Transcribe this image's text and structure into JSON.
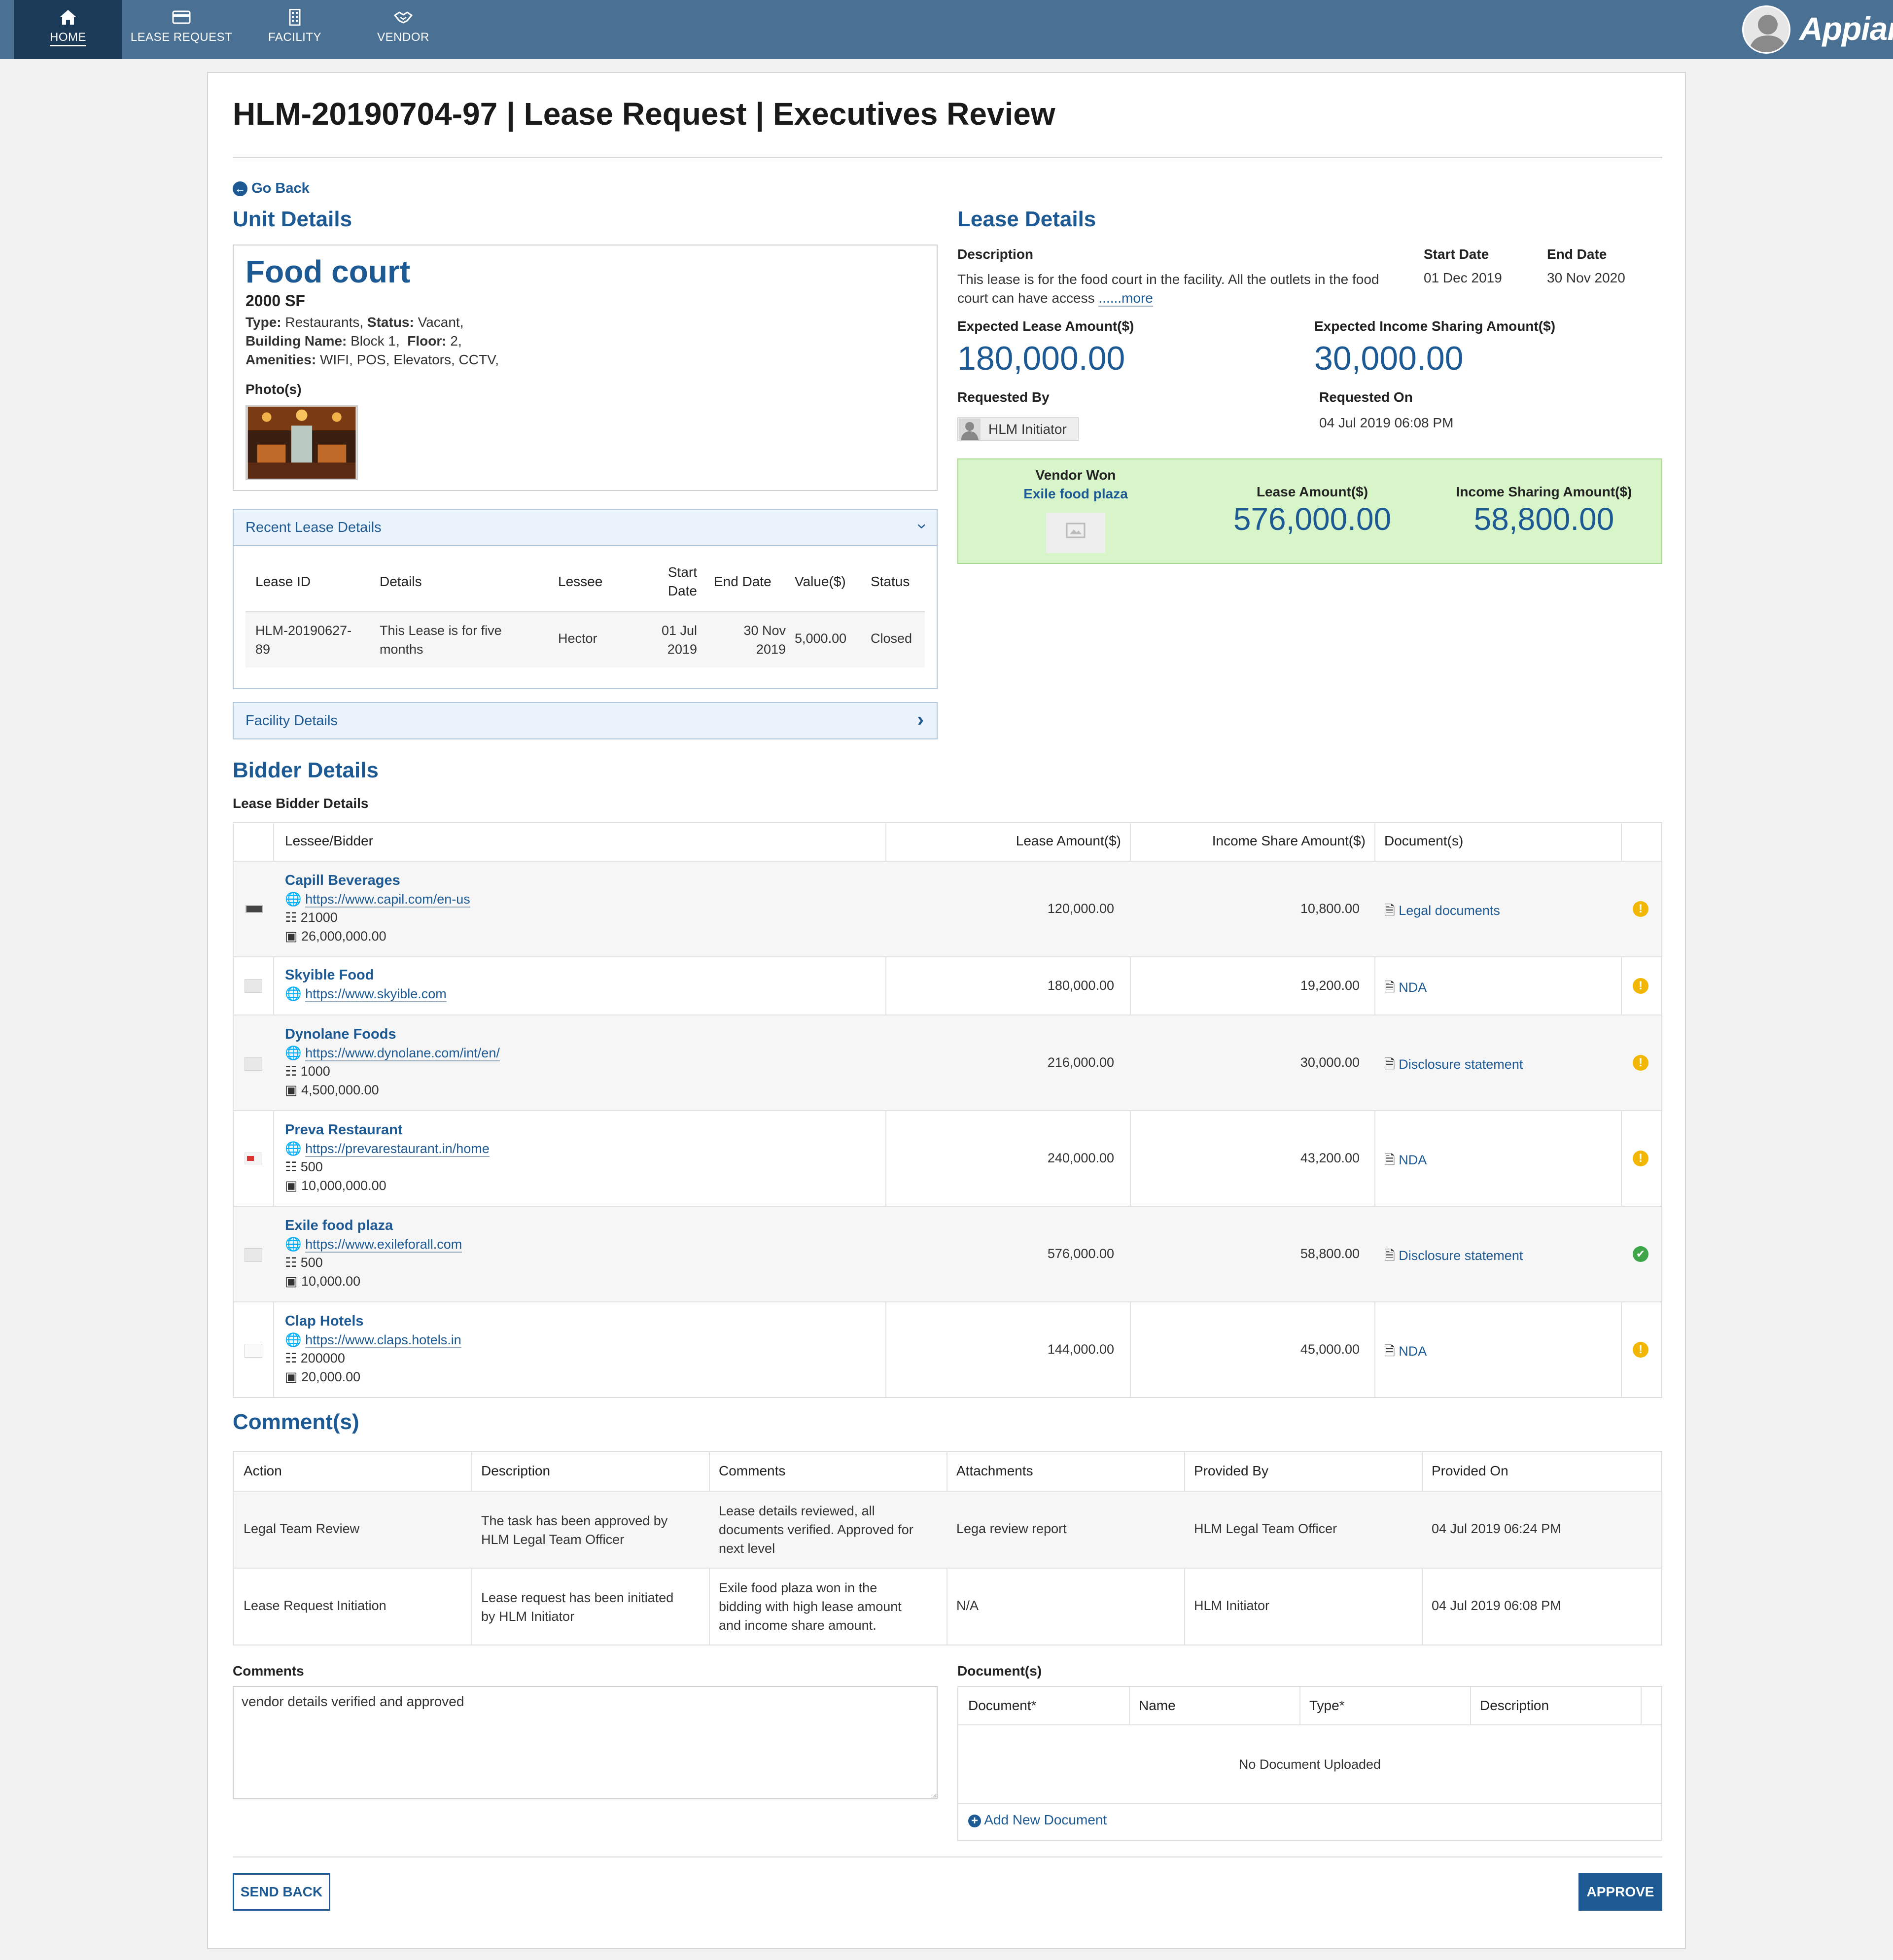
{
  "nav": {
    "tabs": [
      {
        "label": "HOME",
        "icon": "home-icon"
      },
      {
        "label": "LEASE REQUEST",
        "icon": "credit-card-icon"
      },
      {
        "label": "FACILITY",
        "icon": "building-icon"
      },
      {
        "label": "VENDOR",
        "icon": "handshake-icon"
      }
    ],
    "brand": "Appian"
  },
  "page": {
    "title": "HLM-20190704-97 | Lease Request | Executives Review",
    "go_back": "Go Back"
  },
  "unit": {
    "heading": "Unit Details",
    "name": "Food court",
    "area": "2000 SF",
    "type_label": "Type:",
    "type_value": "Restaurants,",
    "status_label": "Status:",
    "status_value": "Vacant,",
    "building_label": "Building Name:",
    "building_value": "Block 1,",
    "floor_label": "Floor:",
    "floor_value": "2,",
    "amenities_label": "Amenities:",
    "amenities_value": "WIFI, POS, Elevators, CCTV,",
    "photos_label": "Photo(s)"
  },
  "recent_lease": {
    "heading": "Recent Lease Details",
    "columns": [
      "Lease ID",
      "Details",
      "Lessee",
      "Start Date",
      "End Date",
      "Value($)",
      "Status"
    ],
    "start_date_l1": "Start",
    "start_date_l2": "Date",
    "row": {
      "lease_id_l1": "HLM-20190627-",
      "lease_id_l2": "89",
      "details_l1": "This Lease is for five",
      "details_l2": "months",
      "lessee": "Hector",
      "start_l1": "01 Jul",
      "start_l2": "2019",
      "end_l1": "30 Nov",
      "end_l2": "2019",
      "value": "5,000.00",
      "status": "Closed"
    }
  },
  "facility": {
    "heading": "Facility Details"
  },
  "lease": {
    "heading": "Lease Details",
    "description_label": "Description",
    "description_l1": "This lease is for the food court in the facility. All the outlets in the food",
    "description_l2": "court can have access ",
    "more": "......more",
    "start_label": "Start Date",
    "start_value": "01 Dec 2019",
    "end_label": "End Date",
    "end_value": "30 Nov 2020",
    "expected_lease_label": "Expected Lease Amount($)",
    "expected_lease_value": "180,000.00",
    "expected_income_label": "Expected Income Sharing Amount($)",
    "expected_income_value": "30,000.00",
    "requested_by_label": "Requested By",
    "requested_by_value": "HLM Initiator",
    "requested_on_label": "Requested On",
    "requested_on_value": "04 Jul 2019 06:08 PM"
  },
  "vendor_won": {
    "label": "Vendor Won",
    "name": "Exile food plaza",
    "lease_label": "Lease Amount($)",
    "lease_value": "576,000.00",
    "income_label": "Income Sharing Amount($)",
    "income_value": "58,800.00"
  },
  "bidders": {
    "heading": "Bidder Details",
    "subheading": "Lease Bidder Details",
    "columns": [
      "Lessee/Bidder",
      "Lease Amount($)",
      "Income Share Amount($)",
      "Document(s)"
    ],
    "rows": [
      {
        "name": "Capill Beverages",
        "url": "https://www.capil.com/en-us",
        "employees": "21000",
        "revenue": "26,000,000.00",
        "lease": "120,000.00",
        "income": "10,800.00",
        "doc": "Legal documents",
        "status": "warning"
      },
      {
        "name": "Skyible Food",
        "url": "https://www.skyible.com",
        "employees": "",
        "revenue": "",
        "lease": "180,000.00",
        "income": "19,200.00",
        "doc": "NDA",
        "status": "warning"
      },
      {
        "name": "Dynolane Foods",
        "url": "https://www.dynolane.com/int/en/",
        "employees": "1000",
        "revenue": "4,500,000.00",
        "lease": "216,000.00",
        "income": "30,000.00",
        "doc": "Disclosure statement",
        "status": "warning"
      },
      {
        "name": "Preva Restaurant",
        "url": "https://prevarestaurant.in/home",
        "employees": "500",
        "revenue": "10,000,000.00",
        "lease": "240,000.00",
        "income": "43,200.00",
        "doc": "NDA",
        "status": "warning"
      },
      {
        "name": "Exile food plaza",
        "url": "https://www.exileforall.com",
        "employees": "500",
        "revenue": "10,000.00",
        "lease": "576,000.00",
        "income": "58,800.00",
        "doc": "Disclosure statement",
        "status": "success"
      },
      {
        "name": "Clap Hotels",
        "url": "https://www.claps.hotels.in",
        "employees": "200000",
        "revenue": "20,000.00",
        "lease": "144,000.00",
        "income": "45,000.00",
        "doc": "NDA",
        "status": "warning"
      }
    ]
  },
  "comments": {
    "heading": "Comment(s)",
    "columns": [
      "Action",
      "Description",
      "Comments",
      "Attachments",
      "Provided By",
      "Provided On"
    ],
    "rows": [
      {
        "action": "Legal Team Review",
        "desc_l1": "The task has been approved by",
        "desc_l2": "HLM Legal Team Officer",
        "com_l1": "Lease details reviewed, all",
        "com_l2": "documents verified. Approved for",
        "com_l3": "next level",
        "attachment": "Lega review report",
        "by": "HLM Legal Team Officer",
        "on": "04 Jul 2019 06:24 PM"
      },
      {
        "action": "Lease Request Initiation",
        "desc_l1": "Lease request has been initiated",
        "desc_l2": "by HLM Initiator",
        "com_l1": "Exile food plaza won in the",
        "com_l2": "bidding with high lease amount",
        "com_l3": "and income share amount.",
        "attachment": "N/A",
        "by": "HLM Initiator",
        "on": "04 Jul 2019 06:08 PM"
      }
    ]
  },
  "form": {
    "comments_label": "Comments",
    "comments_value": "vendor details verified and approved",
    "documents_label": "Document(s)",
    "doc_columns": [
      "Document*",
      "Name",
      "Type*",
      "Description"
    ],
    "no_docs": "No Document Uploaded",
    "add_doc": "Add New Document"
  },
  "actions": {
    "send_back": "SEND BACK",
    "approve": "APPROVE"
  },
  "colors": {
    "nav": "#4a7194",
    "nav_active": "#1b3b58",
    "accent": "#1d5a94",
    "vendor_won_bg": "#d7f5c9",
    "warning": "#f2b705",
    "success": "#3ea549"
  }
}
